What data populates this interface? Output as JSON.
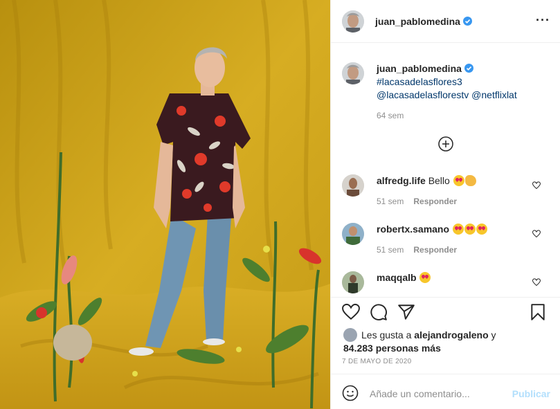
{
  "post": {
    "author": "juan_pablomedina",
    "verified": true,
    "more_icon": "···"
  },
  "caption": {
    "author": "juan_pablomedina",
    "lines": [
      "#lacasadelasflores3",
      "@lacasadelasflorestv @netflixlat"
    ],
    "time": "64 sem"
  },
  "comments": [
    {
      "user": "alfredg.life",
      "text": "Bello",
      "emojis": [
        "heart-eyes",
        "clap"
      ],
      "time": "51 sem",
      "reply": "Responder"
    },
    {
      "user": "robertx.samano",
      "text": "",
      "emojis": [
        "heart-eyes",
        "heart-eyes",
        "heart-eyes"
      ],
      "time": "51 sem",
      "reply": "Responder"
    },
    {
      "user": "maqqalb",
      "text": "",
      "emojis": [
        "heart-eyes"
      ],
      "time": "",
      "reply": ""
    }
  ],
  "likes": {
    "prefix": "Les gusta a",
    "user": "alejandrogaleno",
    "joiner": "y",
    "count": "84.283 personas más"
  },
  "date": "7 DE MAYO DE 2020",
  "add_comment": {
    "placeholder": "Añade un comentario...",
    "post_label": "Publicar"
  },
  "colors": {
    "backdrop": "#c9a017",
    "link": "#00376b",
    "verified": "#3897f0",
    "post_button": "#b2dffc"
  }
}
